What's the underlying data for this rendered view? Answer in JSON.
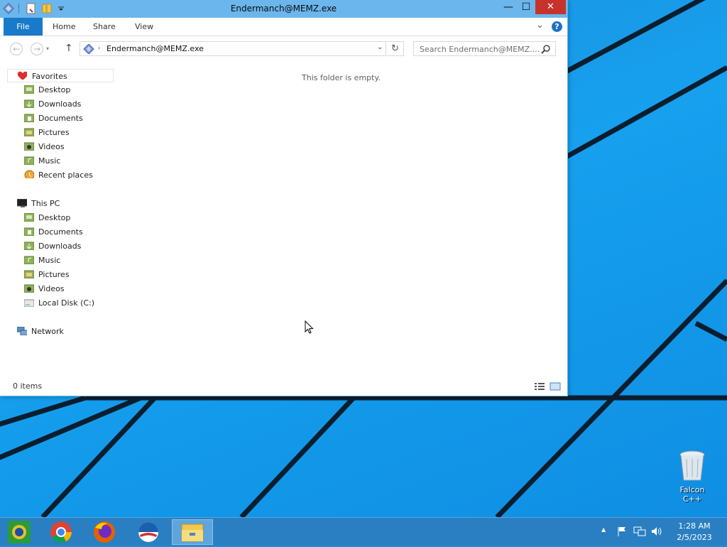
{
  "window": {
    "title": "Endermanch@MEMZ.exe",
    "minimize_symbol": "—",
    "maximize_symbol": "☐",
    "close_symbol": "✕"
  },
  "ribbon": {
    "tabs": [
      "File",
      "Home",
      "Share",
      "View"
    ],
    "help_label": "?",
    "expand_symbol": "⌄"
  },
  "navigation": {
    "back_symbol": "←",
    "forward_symbol": "→",
    "up_symbol": "↑",
    "address_text": "Endermanch@MEMZ.exe",
    "address_separator": "›",
    "refresh_symbol": "↻",
    "search_placeholder": "Search Endermanch@MEMZ...."
  },
  "nav_pane": {
    "favorites": {
      "label": "Favorites",
      "items": [
        {
          "label": "Desktop",
          "icon": "desktop-icon"
        },
        {
          "label": "Downloads",
          "icon": "downloads-icon"
        },
        {
          "label": "Documents",
          "icon": "documents-icon"
        },
        {
          "label": "Pictures",
          "icon": "pictures-icon"
        },
        {
          "label": "Videos",
          "icon": "videos-icon"
        },
        {
          "label": "Music",
          "icon": "music-icon"
        },
        {
          "label": "Recent places",
          "icon": "recent-places-icon"
        }
      ]
    },
    "this_pc": {
      "label": "This PC",
      "items": [
        {
          "label": "Desktop",
          "icon": "desktop-icon"
        },
        {
          "label": "Documents",
          "icon": "documents-icon"
        },
        {
          "label": "Downloads",
          "icon": "downloads-icon"
        },
        {
          "label": "Music",
          "icon": "music-icon"
        },
        {
          "label": "Pictures",
          "icon": "pictures-icon"
        },
        {
          "label": "Videos",
          "icon": "videos-icon"
        },
        {
          "label": "Local Disk (C:)",
          "icon": "local-disk-icon"
        }
      ]
    },
    "network": {
      "label": "Network"
    }
  },
  "content": {
    "empty_message": "This folder is empty."
  },
  "status_bar": {
    "item_count": "0 items"
  },
  "desktop": {
    "recycle_bin_label": "Falcon C++"
  },
  "taskbar": {
    "apps": [
      "app1-icon",
      "chrome-icon",
      "firefox-icon",
      "obama-logo-icon",
      "file-explorer-icon"
    ],
    "tray_arrow": "▲",
    "time": "1:28 AM",
    "date": "2/5/2023"
  },
  "colors": {
    "titlebar": "#6bb6ec",
    "file_tab": "#1979ca",
    "close_button": "#c7332b",
    "taskbar": "#2a7fc2",
    "desktop": "#1a8fe0"
  }
}
